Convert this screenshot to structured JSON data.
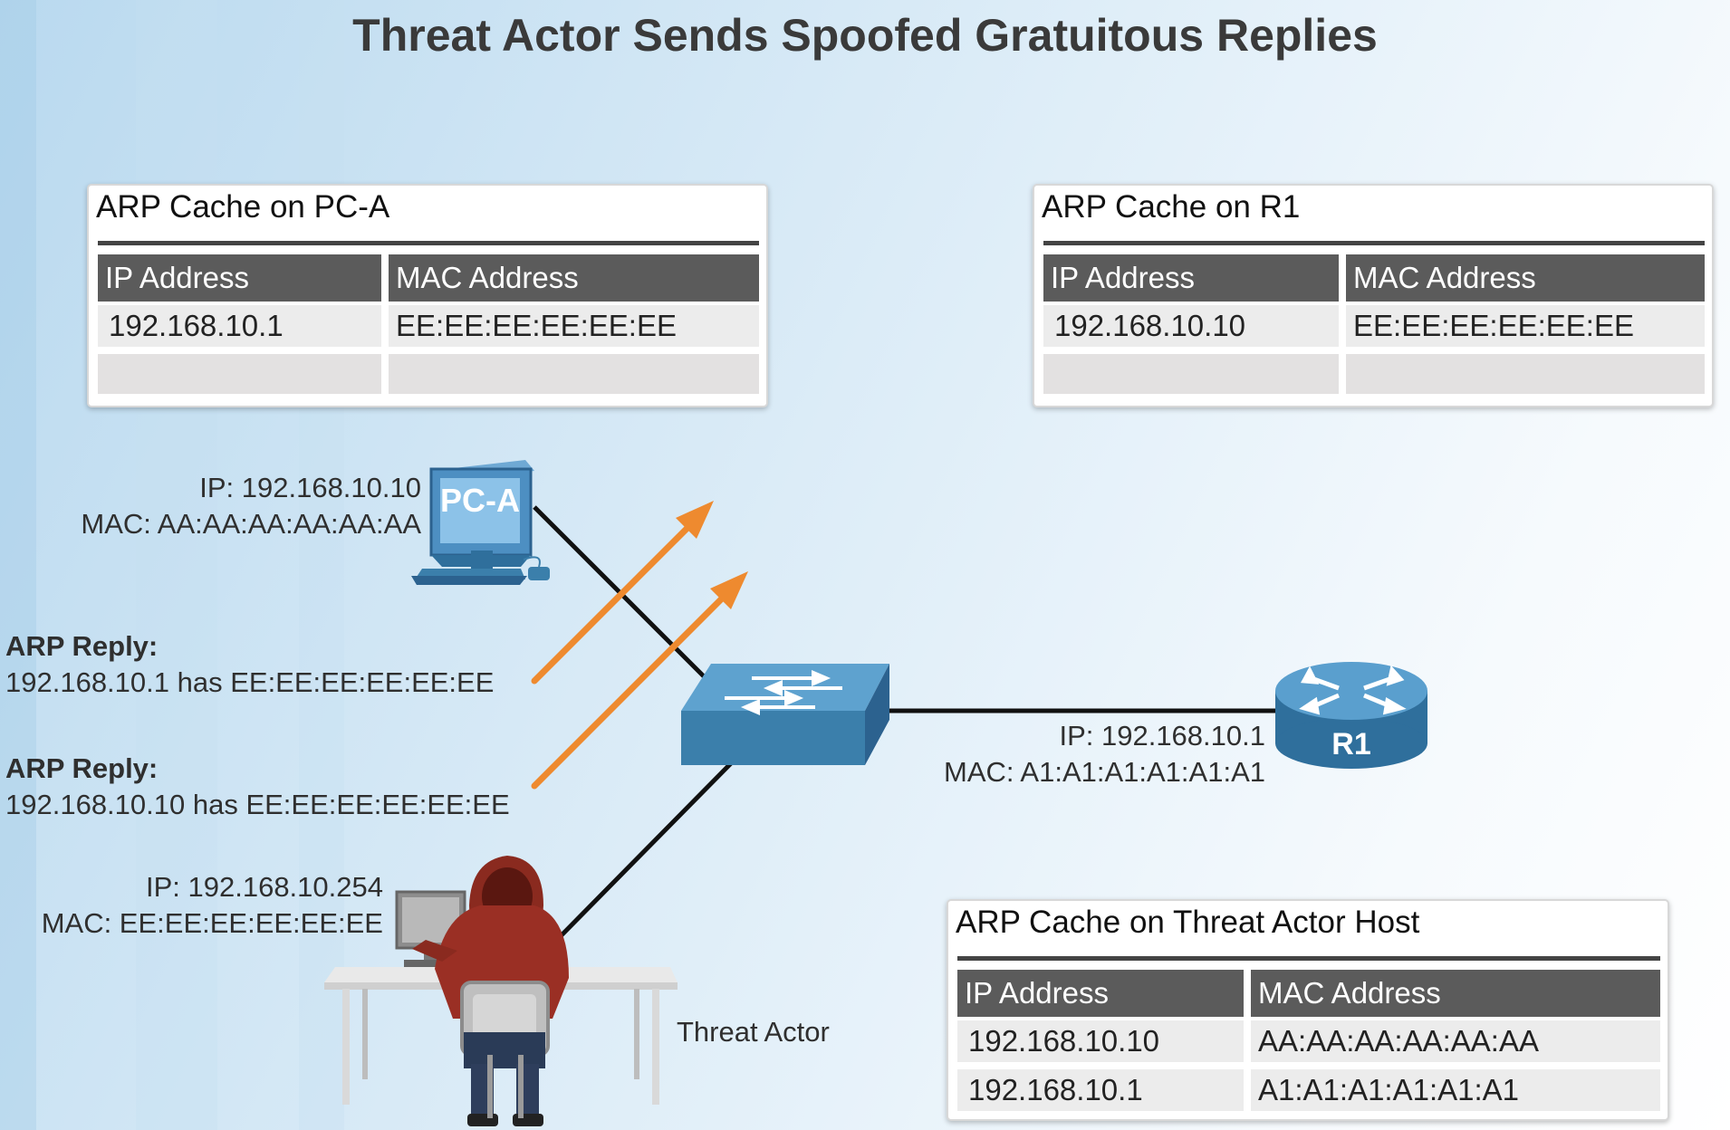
{
  "title": "Threat Actor Sends Spoofed Gratuitous Replies",
  "colors": {
    "arrow": "#ee8a2f",
    "table_header": "#5b5b5b",
    "switch": "#3b7fab",
    "router": "#2f6f9c"
  },
  "caches": {
    "pc_a": {
      "title": "ARP Cache on PC-A",
      "headers": [
        "IP Address",
        "MAC Address"
      ],
      "rows": [
        [
          "192.168.10.1",
          "EE:EE:EE:EE:EE:EE"
        ],
        [
          "",
          ""
        ]
      ]
    },
    "r1": {
      "title": "ARP Cache on R1",
      "headers": [
        "IP Address",
        "MAC Address"
      ],
      "rows": [
        [
          "192.168.10.10",
          "EE:EE:EE:EE:EE:EE"
        ],
        [
          "",
          ""
        ]
      ]
    },
    "threat": {
      "title": "ARP Cache on Threat Actor Host",
      "headers": [
        "IP Address",
        "MAC Address"
      ],
      "rows": [
        [
          "192.168.10.10",
          "AA:AA:AA:AA:AA:AA"
        ],
        [
          "192.168.10.1",
          "A1:A1:A1:A1:A1:A1"
        ]
      ]
    }
  },
  "devices": {
    "pc_a": {
      "label": "PC-A",
      "ip": "IP: 192.168.10.10",
      "mac": "MAC: AA:AA:AA:AA:AA:AA",
      "icon": "pc-icon"
    },
    "r1": {
      "label": "R1",
      "ip": "IP: 192.168.10.1",
      "mac": "MAC: A1:A1:A1:A1:A1:A1",
      "icon": "router-icon"
    },
    "threat_actor": {
      "label": "Threat Actor",
      "ip": "IP: 192.168.10.254",
      "mac": "MAC: EE:EE:EE:EE:EE:EE",
      "icon": "hacker-icon"
    },
    "switch": {
      "icon": "switch-icon"
    }
  },
  "replies": [
    {
      "heading": "ARP Reply:",
      "text": "192.168.10.1 has EE:EE:EE:EE:EE:EE"
    },
    {
      "heading": "ARP Reply:",
      "text": "192.168.10.10 has EE:EE:EE:EE:EE:EE"
    }
  ]
}
